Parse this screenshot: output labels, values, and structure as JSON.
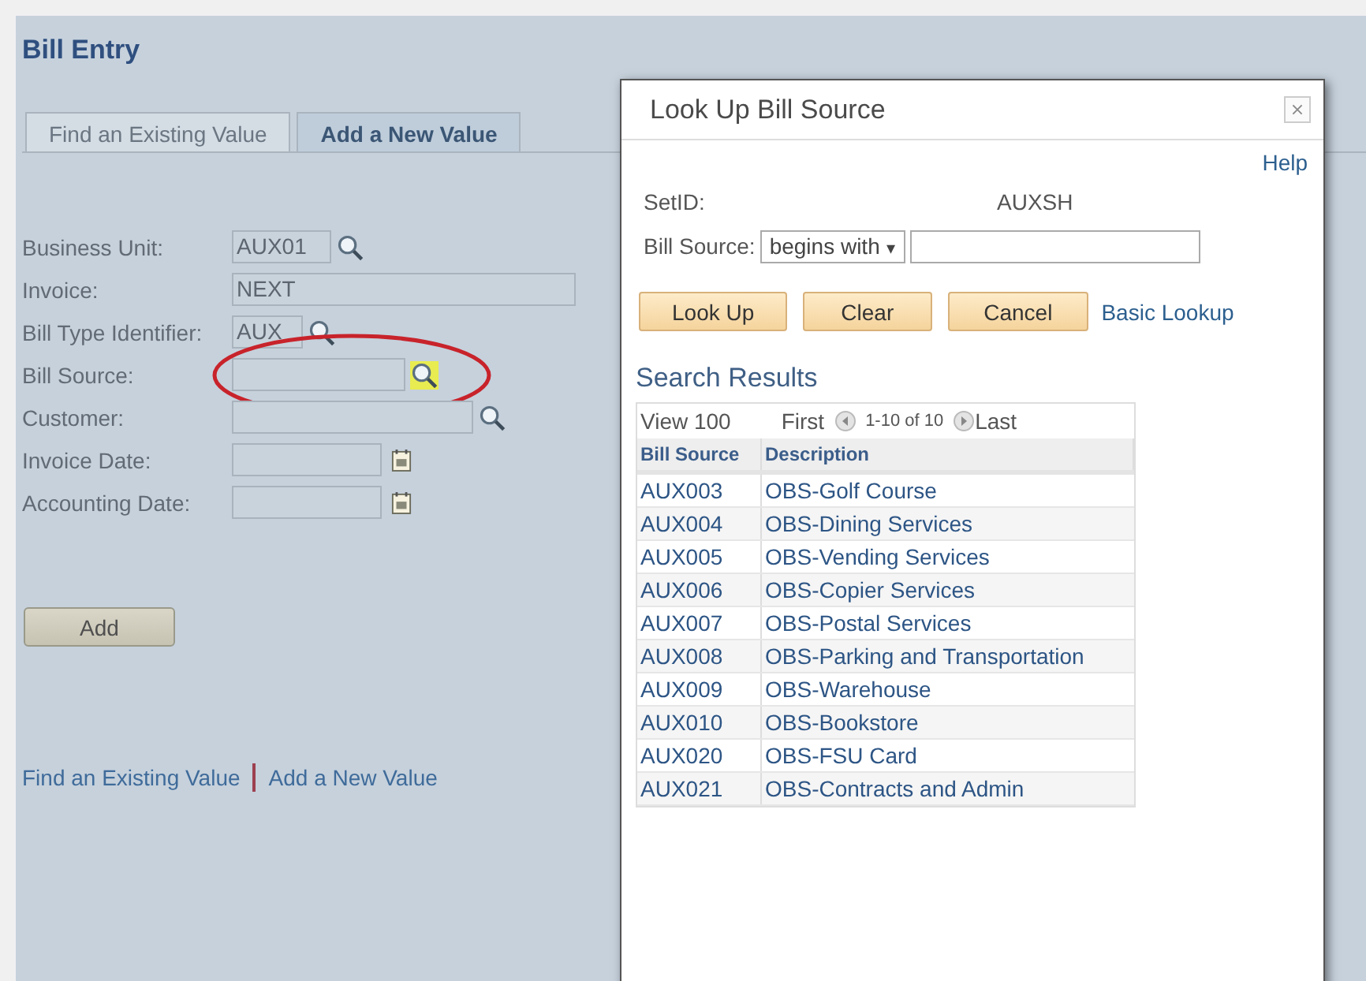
{
  "page": {
    "title": "Bill Entry"
  },
  "tabs": [
    {
      "label": "Find an Existing Value",
      "selected": false
    },
    {
      "label": "Add a New Value",
      "selected": true
    }
  ],
  "fields": [
    {
      "label": "Business Unit:",
      "kind": "lookup",
      "value": "AUX01",
      "highlighted": false
    },
    {
      "label": "Invoice:",
      "kind": "text",
      "value": "NEXT",
      "highlighted": false
    },
    {
      "label": "Bill Type Identifier:",
      "kind": "lookup",
      "value": "AUX",
      "highlighted": false
    },
    {
      "label": "Bill Source:",
      "kind": "lookup",
      "highlighted": true
    },
    {
      "label": "Customer:",
      "kind": "lookup",
      "highlighted": false
    },
    {
      "label": "Invoice Date:",
      "kind": "date",
      "highlighted": false
    },
    {
      "label": "Accounting Date:",
      "kind": "date",
      "highlighted": false
    }
  ],
  "add_button": "Add",
  "bottom_links": [
    "Find an Existing Value",
    "Add a New Value"
  ],
  "dialog": {
    "title": "Look Up Bill Source",
    "help": "Help",
    "setid": {
      "label": "SetID:",
      "value": "AUXSH"
    },
    "bill_source": {
      "label": "Bill Source:",
      "operator": "begins with",
      "caret": "▾"
    },
    "buttons": [
      "Look Up",
      "Clear",
      "Cancel"
    ],
    "basic_lookup": "Basic Lookup",
    "results_title": "Search Results",
    "nav": {
      "view": "View 100",
      "first": "First",
      "range": "1-10 of 10",
      "last": "Last"
    },
    "columns": [
      "Bill Source",
      "Description"
    ],
    "rows": [
      {
        "code": "AUX003",
        "description": "OBS-Golf Course"
      },
      {
        "code": "AUX004",
        "description": "OBS-Dining Services"
      },
      {
        "code": "AUX005",
        "description": "OBS-Vending Services"
      },
      {
        "code": "AUX006",
        "description": "OBS-Copier Services"
      },
      {
        "code": "AUX007",
        "description": "OBS-Postal Services"
      },
      {
        "code": "AUX008",
        "description": "OBS-Parking and Transportation"
      },
      {
        "code": "AUX009",
        "description": "OBS-Warehouse"
      },
      {
        "code": "AUX010",
        "description": "OBS-Bookstore"
      },
      {
        "code": "AUX020",
        "description": "OBS-FSU Card"
      },
      {
        "code": "AUX021",
        "description": "OBS-Contracts and Admin"
      }
    ]
  }
}
